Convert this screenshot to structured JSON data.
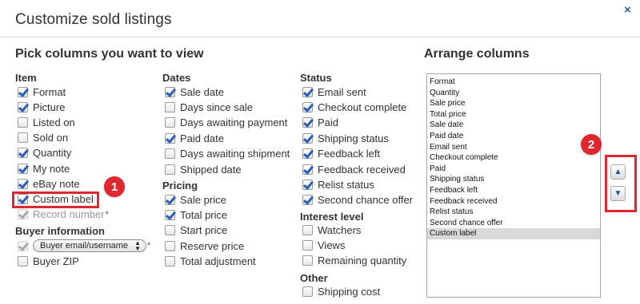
{
  "dialog": {
    "title": "Customize sold listings",
    "close_label": "×"
  },
  "pick": {
    "heading": "Pick columns you want to view",
    "item": {
      "heading": "Item",
      "options": [
        {
          "label": "Format",
          "checked": true
        },
        {
          "label": "Picture",
          "checked": true
        },
        {
          "label": "Listed on",
          "checked": false
        },
        {
          "label": "Sold on",
          "checked": false
        },
        {
          "label": "Quantity",
          "checked": true
        },
        {
          "label": "My note",
          "checked": true
        },
        {
          "label": "eBay note",
          "checked": true
        },
        {
          "label": "Custom label",
          "checked": true
        },
        {
          "label": "Record number",
          "checked": true,
          "disabled": true,
          "suffix": "*"
        }
      ]
    },
    "buyer": {
      "heading": "Buyer information",
      "select_value": "Buyer email/username",
      "select_suffix": "*",
      "zip_label": "Buyer ZIP"
    },
    "dates": {
      "heading": "Dates",
      "options": [
        {
          "label": "Sale date",
          "checked": true
        },
        {
          "label": "Days since sale",
          "checked": false
        },
        {
          "label": "Days awaiting payment",
          "checked": false
        },
        {
          "label": "Paid date",
          "checked": true
        },
        {
          "label": "Days awaiting shipment",
          "checked": false
        },
        {
          "label": "Shipped date",
          "checked": false
        }
      ]
    },
    "pricing": {
      "heading": "Pricing",
      "options": [
        {
          "label": "Sale price",
          "checked": true
        },
        {
          "label": "Total price",
          "checked": true
        },
        {
          "label": "Start price",
          "checked": false
        },
        {
          "label": "Reserve price",
          "checked": false
        },
        {
          "label": "Total adjustment",
          "checked": false
        }
      ]
    },
    "status": {
      "heading": "Status",
      "options": [
        {
          "label": "Email sent",
          "checked": true
        },
        {
          "label": "Checkout complete",
          "checked": true
        },
        {
          "label": "Paid",
          "checked": true
        },
        {
          "label": "Shipping status",
          "checked": true
        },
        {
          "label": "Feedback left",
          "checked": true
        },
        {
          "label": "Feedback received",
          "checked": true
        },
        {
          "label": "Relist status",
          "checked": true
        },
        {
          "label": "Second chance offer",
          "checked": true
        }
      ]
    },
    "interest": {
      "heading": "Interest level",
      "options": [
        {
          "label": "Watchers",
          "checked": false
        },
        {
          "label": "Views",
          "checked": false
        },
        {
          "label": "Remaining quantity",
          "checked": false
        }
      ]
    },
    "other": {
      "heading": "Other",
      "options": [
        {
          "label": "Shipping cost",
          "checked": false
        }
      ]
    }
  },
  "arrange": {
    "heading": "Arrange columns",
    "items": [
      "Format",
      "Quantity",
      "Sale price",
      "Total price",
      "Sale date",
      "Paid date",
      "Email sent",
      "Checkout complete",
      "Paid",
      "Shipping status",
      "Feedback left",
      "Feedback received",
      "Relist status",
      "Second chance offer",
      "Custom label"
    ],
    "selected": "Custom label",
    "move_up_icon": "arrow-up-icon",
    "move_down_icon": "arrow-down-icon"
  },
  "annotations": {
    "badge1": "1",
    "badge2": "2",
    "highlight_color": "#e0262e"
  }
}
